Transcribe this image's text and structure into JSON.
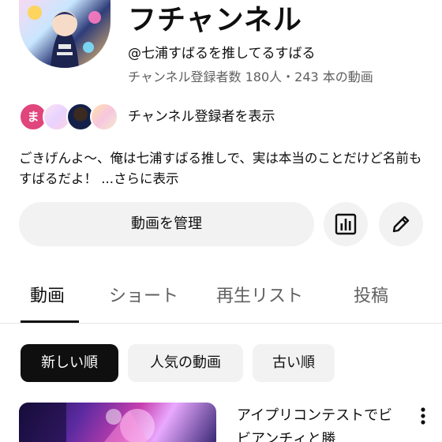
{
  "channel": {
    "title": "フチャンネル",
    "handle": "@七浦すばるを推してるすばる",
    "stats": "チャンネル登録者数 180人・243 本の動画"
  },
  "subscribers": {
    "first_avatar_letter": "ま",
    "label": "チャンネル登録者を表示"
  },
  "description": {
    "text": "ごきげんよ〜、俺は七浦すばる推しで、実は本当のことだけど名前もすばるだよ！",
    "more": " ...さらに表示"
  },
  "actions": {
    "manage_label": "動画を管理",
    "analytics_icon": "analytics-icon",
    "edit_icon": "pencil-icon"
  },
  "tabs": [
    {
      "label": "動画",
      "active": true
    },
    {
      "label": "ショート",
      "active": false
    },
    {
      "label": "再生リスト",
      "active": false
    },
    {
      "label": "投稿",
      "active": false
    }
  ],
  "chips": [
    {
      "label": "新しい順",
      "active": true
    },
    {
      "label": "人気の動画",
      "active": false
    },
    {
      "label": "古い順",
      "active": false
    }
  ],
  "video": {
    "title": "アイプリコンテストでビビアンチィと勝"
  },
  "colors": {
    "text_primary": "#0f0f0f",
    "text_secondary": "#606060",
    "chip_bg": "#f2f2f2",
    "chip_active_bg": "#0f0f0f",
    "first_avatar_bg": "#e0457b"
  }
}
